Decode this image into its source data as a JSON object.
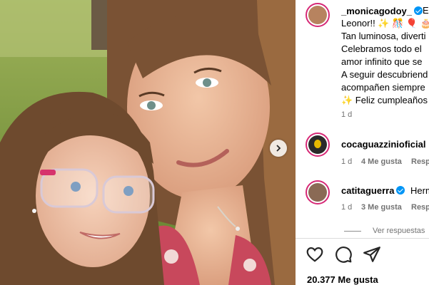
{
  "post": {
    "author": "_monicagodoy_",
    "caption_lines": [
      "E",
      "Leonor!! ✨ 🎊 🎈 🎂",
      "Tan luminosa, diverti",
      "Celebramos todo el",
      "amor infinito que se",
      "A seguir descubriend",
      "acompañen siempre",
      "✨ Feliz cumpleaños"
    ],
    "age": "1 d"
  },
  "comments": [
    {
      "user": "cocaguazzinioficial",
      "age": "1 d",
      "likes": "4 Me gusta",
      "reply": "Resp"
    },
    {
      "user": "catitaguerra",
      "text": "Herm",
      "age": "1 d",
      "likes": "3 Me gusta",
      "reply": "Resp"
    }
  ],
  "view_replies": "Ver respuestas",
  "likes_count": "20.377 Me gusta",
  "icons": [
    "chevron-right-icon",
    "heart-icon",
    "comment-icon",
    "share-icon",
    "verified-icon"
  ]
}
